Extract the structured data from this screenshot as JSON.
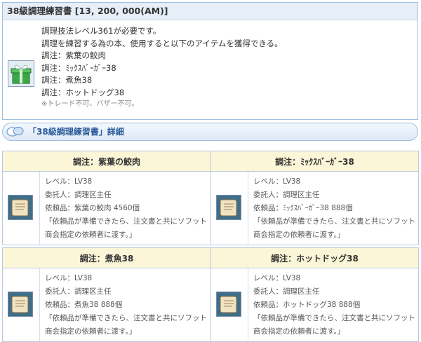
{
  "item": {
    "title": "38級調理練習書 [13, 200, 000(AM)]",
    "lines": [
      "調理技法レベル361が必要です。",
      "調理を練習する為の本、使用すると以下のアイテムを獲得できる。",
      "調注：紫葉の鮫肉",
      "調注：ﾐｯｸｽﾊﾞｰｶﾞｰ38",
      "調注：煮魚38",
      "調注：ホットドッグ38"
    ],
    "note": "※トレード不可、バザー不可。",
    "icon": "gift-box-icon"
  },
  "section": {
    "title": "「38級調理練習書」詳細",
    "icon": "speech-bubble-icon"
  },
  "orders": [
    {
      "title": "調注：紫葉の鮫肉",
      "level": "レベル：LV38",
      "client": "委託人：調理区主任",
      "request": "依頼品：紫葉の鮫肉 4560個",
      "message1": "「依頼品が準備できたら、注文書と共にソフット",
      "message2": "商会指定の依頼者に渡す。」",
      "icon": "scroll-icon"
    },
    {
      "title": "調注：ﾐｯｸｽﾊﾞｰｶﾞｰ38",
      "level": "レベル：LV38",
      "client": "委託人：調理区主任",
      "request": "依頼品：ﾐｯｸｽﾊﾞｰｶﾞｰ38 888個",
      "message1": "「依頼品が準備できたら、注文書と共にソフット",
      "message2": "商会指定の依頼者に渡す。」",
      "icon": "scroll-icon"
    },
    {
      "title": "調注：煮魚38",
      "level": "レベル：LV38",
      "client": "委託人：調理区主任",
      "request": "依頼品：煮魚38 888個",
      "message1": "「依頼品が準備できたら、注文書と共にソフット",
      "message2": "商会指定の依頼者に渡す。」",
      "icon": "scroll-icon"
    },
    {
      "title": "調注：ホットドッグ38",
      "level": "レベル：LV38",
      "client": "委託人：調理区主任",
      "request": "依頼品：ホットドッグ38 888個",
      "message1": "「依頼品が準備できたら、注文書と共にソフット",
      "message2": "商会指定の依頼者に渡す。」",
      "icon": "scroll-icon"
    }
  ]
}
